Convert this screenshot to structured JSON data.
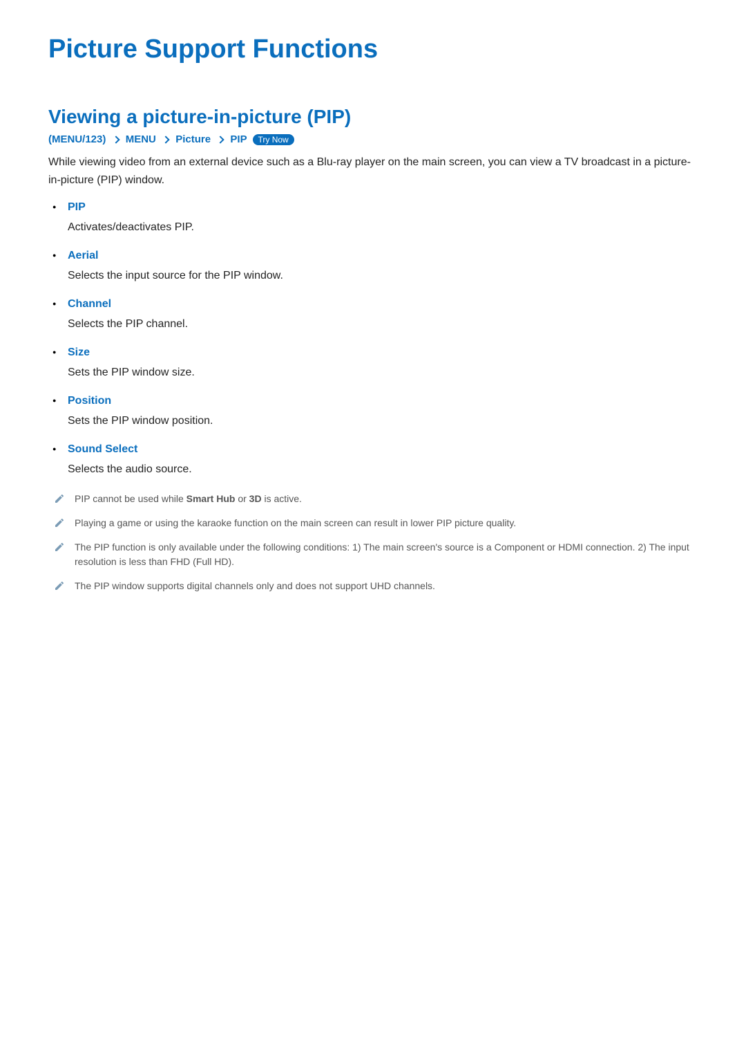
{
  "page_title": "Picture Support Functions",
  "section_title": "Viewing a picture-in-picture (PIP)",
  "breadcrumb": {
    "open": "(",
    "part1": "MENU/123",
    "close": ")",
    "part2": "MENU",
    "part3": "Picture",
    "part4": "PIP",
    "try_now": "Try Now"
  },
  "intro": "While viewing video from an external device such as a Blu-ray player on the main screen, you can view a TV broadcast in a picture-in-picture (PIP) window.",
  "items": [
    {
      "title": "PIP",
      "desc": "Activates/deactivates PIP."
    },
    {
      "title": "Aerial",
      "desc": "Selects the input source for the PIP window."
    },
    {
      "title": "Channel",
      "desc": "Selects the PIP channel."
    },
    {
      "title": "Size",
      "desc": "Sets the PIP window size."
    },
    {
      "title": "Position",
      "desc": "Sets the PIP window position."
    },
    {
      "title": "Sound Select",
      "desc": "Selects the audio source."
    }
  ],
  "notes": {
    "n0_a": "PIP cannot be used while ",
    "n0_b": "Smart Hub",
    "n0_c": " or ",
    "n0_d": "3D",
    "n0_e": " is active.",
    "n1": "Playing a game or using the karaoke function on the main screen can result in lower PIP picture quality.",
    "n2": "The PIP function is only available under the following conditions: 1) The main screen's source is a Component or HDMI connection. 2) The input resolution is less than FHD (Full HD).",
    "n3": "The PIP window supports digital channels only and does not support UHD channels."
  }
}
